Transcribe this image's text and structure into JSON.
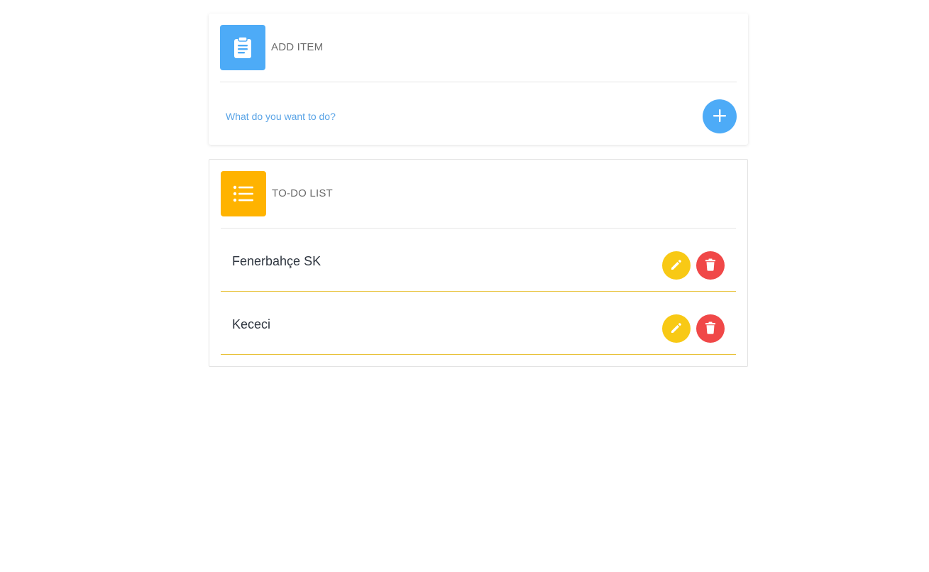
{
  "add_card": {
    "title": "ADD ITEM",
    "icon": "clipboard-icon",
    "input_placeholder": "What do you want to do?",
    "input_value": "",
    "add_button_icon": "plus-icon"
  },
  "list_card": {
    "title": "TO-DO LIST",
    "icon": "list-icon",
    "items": [
      {
        "text": "Fenerbahçe SK",
        "edit_icon": "pencil-icon",
        "delete_icon": "trash-icon"
      },
      {
        "text": "Kececi",
        "edit_icon": "pencil-icon",
        "delete_icon": "trash-icon"
      }
    ]
  },
  "colors": {
    "blue": "#4dabf7",
    "amber": "#ffb300",
    "edit_yellow": "#f8c915",
    "delete_red": "#f04848",
    "item_border": "#e8c23a"
  }
}
